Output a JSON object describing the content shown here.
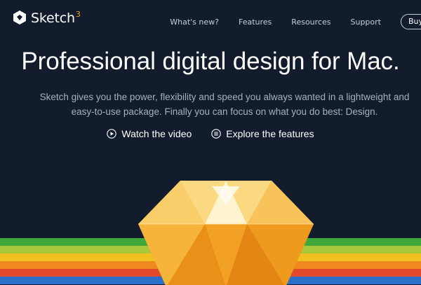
{
  "brand": {
    "name": "Sketch",
    "version": "3"
  },
  "nav": {
    "items": [
      "What's new?",
      "Features",
      "Resources",
      "Support"
    ],
    "buy_label": "Buy"
  },
  "hero": {
    "headline": "Professional digital design for Mac.",
    "subtext_line1": "Sketch gives you the power, flexibility and speed you always wanted in a lightweight and",
    "subtext_line2": "easy-to-use package. Finally you can focus on what you do best: Design.",
    "cta_video": "Watch the video",
    "cta_features": "Explore the features"
  },
  "icons": {
    "logo": "diamond-logo-icon",
    "video": "play-circle-icon",
    "features": "list-circle-icon"
  },
  "colors": {
    "background": "#121c2c",
    "version_accent": "#f0a020",
    "rainbow": [
      "#3fa83a",
      "#a8c83a",
      "#f0c020",
      "#f08820",
      "#e04a2a",
      "#2a70c8"
    ]
  }
}
